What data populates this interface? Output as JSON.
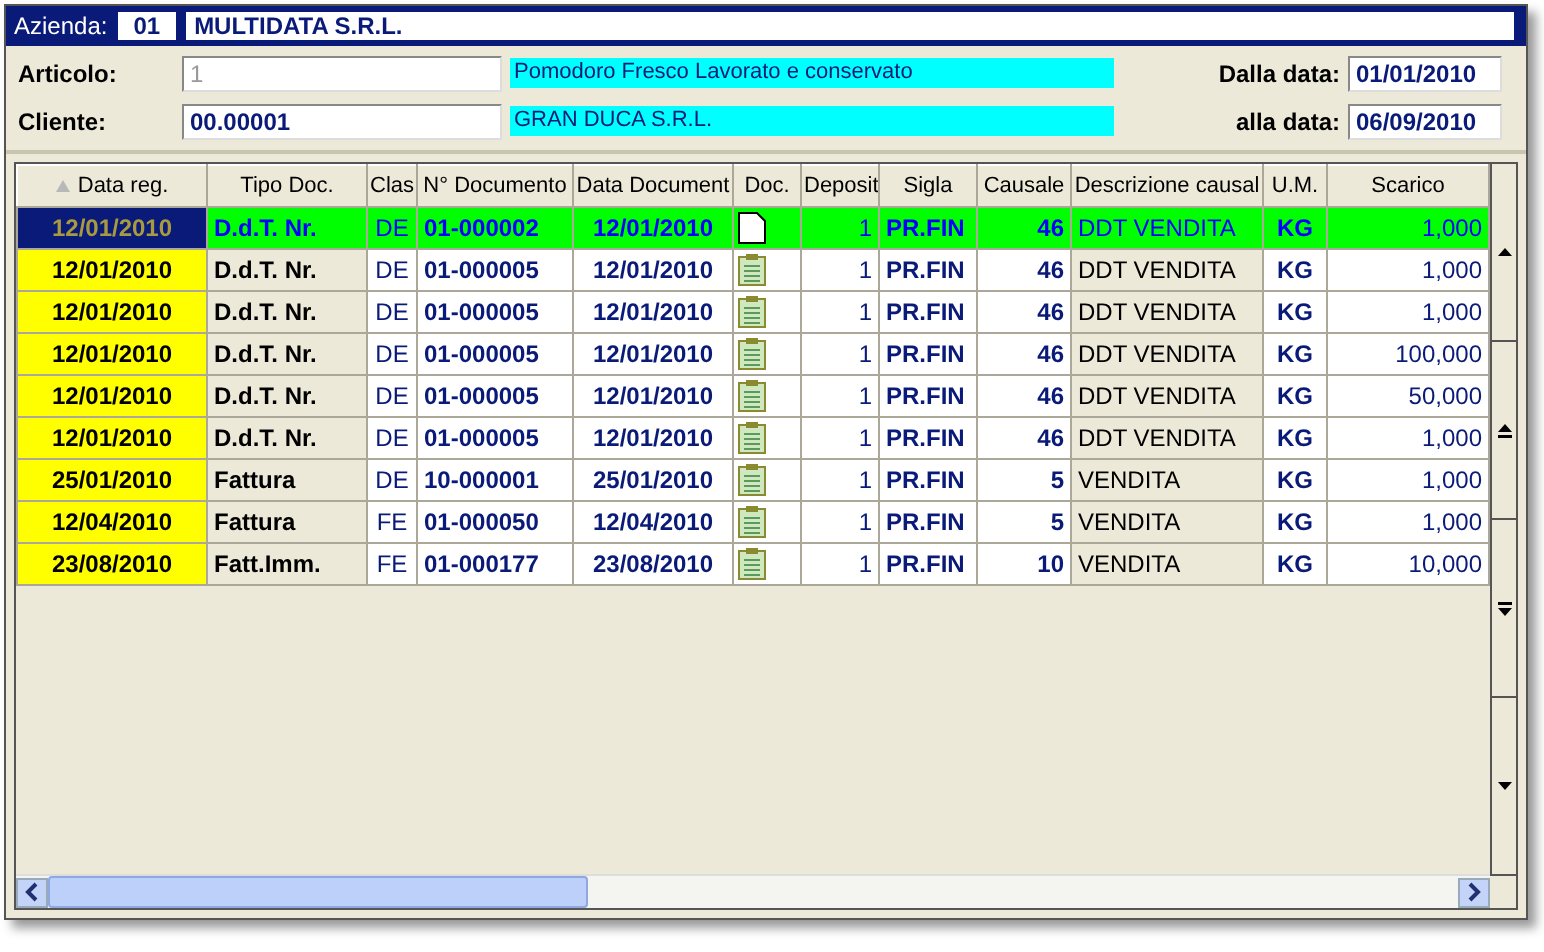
{
  "company": {
    "label": "Azienda:",
    "code": "01",
    "name": "MULTIDATA S.R.L."
  },
  "filters": {
    "article_label": "Articolo:",
    "article_code": "1",
    "article_desc": "Pomodoro Fresco Lavorato e conservato",
    "client_label": "Cliente:",
    "client_code": "00.00001",
    "client_desc": "GRAN DUCA S.R.L.",
    "from_label": "Dalla data:",
    "from_date": "01/01/2010",
    "to_label": "alla data:",
    "to_date": "06/09/2010"
  },
  "table": {
    "columns": [
      "Data reg.",
      "Tipo Doc.",
      "Clas",
      "N° Documento",
      "Data Document",
      "Doc.",
      "Deposit",
      "Sigla",
      "Causale",
      "Descrizione causal",
      "U.M.",
      "Scarico"
    ],
    "rows": [
      {
        "selected": true,
        "has_note": false,
        "cells": [
          "12/01/2010",
          "D.d.T. Nr.",
          "DE",
          "01-000002",
          "12/01/2010",
          "",
          "1",
          "PR.FIN",
          "46",
          "DDT VENDITA",
          "KG",
          "1,000"
        ]
      },
      {
        "selected": false,
        "has_note": true,
        "cells": [
          "12/01/2010",
          "D.d.T. Nr.",
          "DE",
          "01-000005",
          "12/01/2010",
          "",
          "1",
          "PR.FIN",
          "46",
          "DDT VENDITA",
          "KG",
          "1,000"
        ]
      },
      {
        "selected": false,
        "has_note": true,
        "cells": [
          "12/01/2010",
          "D.d.T. Nr.",
          "DE",
          "01-000005",
          "12/01/2010",
          "",
          "1",
          "PR.FIN",
          "46",
          "DDT VENDITA",
          "KG",
          "1,000"
        ]
      },
      {
        "selected": false,
        "has_note": true,
        "cells": [
          "12/01/2010",
          "D.d.T. Nr.",
          "DE",
          "01-000005",
          "12/01/2010",
          "",
          "1",
          "PR.FIN",
          "46",
          "DDT VENDITA",
          "KG",
          "100,000"
        ]
      },
      {
        "selected": false,
        "has_note": true,
        "cells": [
          "12/01/2010",
          "D.d.T. Nr.",
          "DE",
          "01-000005",
          "12/01/2010",
          "",
          "1",
          "PR.FIN",
          "46",
          "DDT VENDITA",
          "KG",
          "50,000"
        ]
      },
      {
        "selected": false,
        "has_note": true,
        "cells": [
          "12/01/2010",
          "D.d.T. Nr.",
          "DE",
          "01-000005",
          "12/01/2010",
          "",
          "1",
          "PR.FIN",
          "46",
          "DDT VENDITA",
          "KG",
          "1,000"
        ]
      },
      {
        "selected": false,
        "has_note": true,
        "cells": [
          "25/01/2010",
          "Fattura",
          "DE",
          "10-000001",
          "25/01/2010",
          "",
          "1",
          "PR.FIN",
          "5",
          "VENDITA",
          "KG",
          "1,000"
        ]
      },
      {
        "selected": false,
        "has_note": true,
        "cells": [
          "12/04/2010",
          "Fattura",
          "FE",
          "01-000050",
          "12/04/2010",
          "",
          "1",
          "PR.FIN",
          "5",
          "VENDITA",
          "KG",
          "1,000"
        ]
      },
      {
        "selected": false,
        "has_note": true,
        "cells": [
          "23/08/2010",
          "Fatt.Imm.",
          "FE",
          "01-000177",
          "23/08/2010",
          "",
          "1",
          "PR.FIN",
          "10",
          "VENDITA",
          "KG",
          "10,000"
        ]
      }
    ]
  }
}
